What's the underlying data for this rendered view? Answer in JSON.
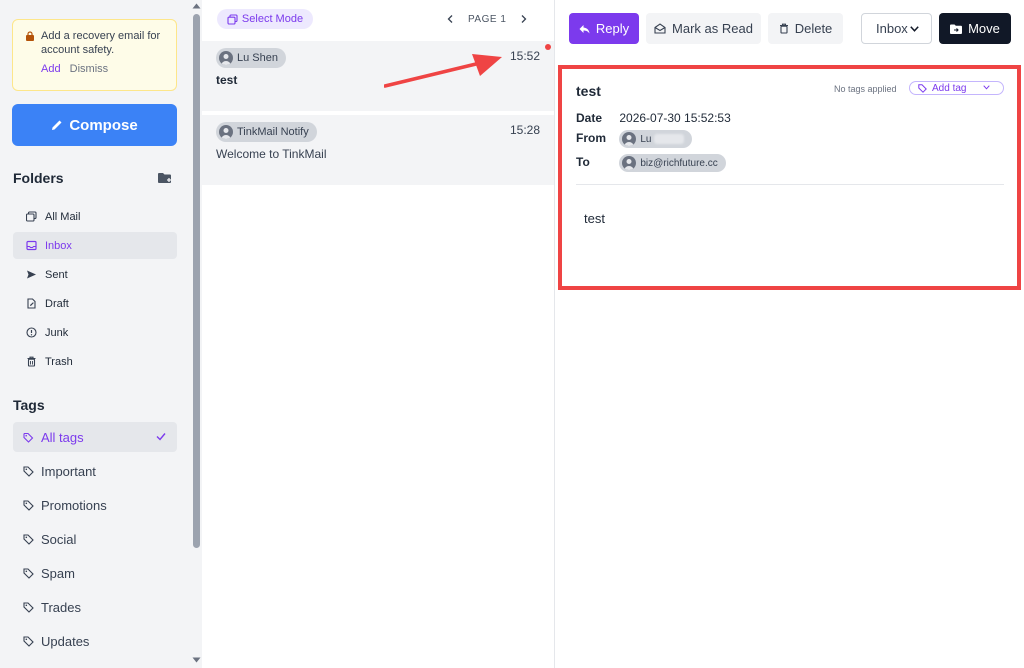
{
  "sidebar": {
    "recovery": {
      "message": "Add a recovery email for account safety.",
      "add_label": "Add",
      "dismiss_label": "Dismiss"
    },
    "compose_label": "Compose",
    "folders_title": "Folders",
    "folders": [
      {
        "label": "All Mail",
        "icon": "all-mail-icon"
      },
      {
        "label": "Inbox",
        "icon": "inbox-icon",
        "active": true
      },
      {
        "label": "Sent",
        "icon": "send-icon"
      },
      {
        "label": "Draft",
        "icon": "draft-icon"
      },
      {
        "label": "Junk",
        "icon": "junk-icon"
      },
      {
        "label": "Trash",
        "icon": "trash-icon"
      }
    ],
    "tags_title": "Tags",
    "tags": [
      {
        "label": "All tags",
        "active": true
      },
      {
        "label": "Important"
      },
      {
        "label": "Promotions"
      },
      {
        "label": "Social"
      },
      {
        "label": "Spam"
      },
      {
        "label": "Trades"
      },
      {
        "label": "Updates"
      }
    ]
  },
  "list": {
    "select_mode_label": "Select Mode",
    "page_label": "PAGE 1",
    "messages": [
      {
        "sender": "Lu Shen",
        "time": "15:52",
        "subject": "test",
        "unread": true
      },
      {
        "sender": "TinkMail Notify",
        "time": "15:28",
        "subject": "Welcome to TinkMail",
        "unread": false
      }
    ]
  },
  "toolbar": {
    "reply_label": "Reply",
    "mark_read_label": "Mark as Read",
    "delete_label": "Delete",
    "folder_select_value": "Inbox",
    "move_label": "Move"
  },
  "message": {
    "subject": "test",
    "no_tags_text": "No tags applied",
    "add_tag_label": "Add tag",
    "date_label": "Date",
    "date_value": "2026-07-30 15:52:53",
    "from_label": "From",
    "from_value": "Lu",
    "to_label": "To",
    "to_value": "biz@richfuture.cc",
    "body": "test"
  },
  "colors": {
    "accent": "#7c3aed",
    "compose": "#3b82f6",
    "highlight": "#ef4444",
    "move_button": "#111827"
  }
}
